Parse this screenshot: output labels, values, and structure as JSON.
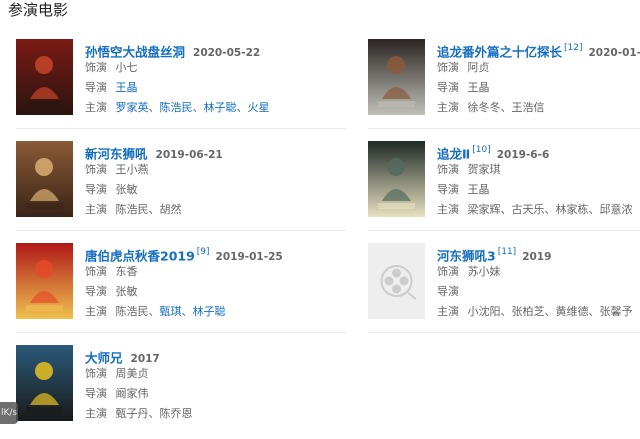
{
  "section": {
    "title": "参演电影"
  },
  "films": [
    {
      "name": "孙悟空大战盘丝洞",
      "ref": "",
      "date": "2020-05-22",
      "role_label": "饰演",
      "role": "小七",
      "director_label": "导演",
      "directors": [
        {
          "text": "王晶",
          "link": true
        }
      ],
      "cast_label": "主演",
      "cast": [
        {
          "text": "罗家英",
          "link": true
        },
        {
          "text": "陈浩民",
          "link": true
        },
        {
          "text": "林子聪",
          "link": true
        },
        {
          "text": "火星",
          "link": true
        }
      ],
      "poster_colors": [
        "#7a1a14",
        "#c8452a",
        "#2a1410"
      ]
    },
    {
      "name": "追龙番外篇之十亿探长",
      "ref": "[12]",
      "date": "2020-01-16",
      "role_label": "饰演",
      "role": "阿贞",
      "director_label": "导演",
      "directors": [
        {
          "text": "王晶",
          "link": false
        }
      ],
      "cast_label": "主演",
      "cast": [
        {
          "text": "徐冬冬",
          "link": false
        },
        {
          "text": "王浩信",
          "link": false
        }
      ],
      "poster_colors": [
        "#2a2422",
        "#8a5a3a",
        "#c0c0b8"
      ]
    },
    {
      "name": "新河东狮吼",
      "ref": "",
      "date": "2019-06-21",
      "role_label": "饰演",
      "role": "王小燕",
      "director_label": "导演",
      "directors": [
        {
          "text": "张敏",
          "link": false
        }
      ],
      "cast_label": "主演",
      "cast": [
        {
          "text": "陈浩民",
          "link": false
        },
        {
          "text": "胡然",
          "link": false
        }
      ],
      "poster_colors": [
        "#8a5a36",
        "#d8b070",
        "#3a2418"
      ]
    },
    {
      "name": "追龙Ⅱ",
      "ref": "[10]",
      "date": "2019-6-6",
      "role_label": "饰演",
      "role": "贺家琪",
      "director_label": "导演",
      "directors": [
        {
          "text": "王晶",
          "link": false
        }
      ],
      "cast_label": "主演",
      "cast": [
        {
          "text": "梁家辉",
          "link": false
        },
        {
          "text": "古天乐",
          "link": false
        },
        {
          "text": "林家栋",
          "link": false
        },
        {
          "text": "邱意浓",
          "link": false
        }
      ],
      "poster_colors": [
        "#1e2a26",
        "#546a5e",
        "#e8e0c0"
      ]
    },
    {
      "name": "唐伯虎点秋香2019",
      "ref": "[9]",
      "date": "2019-01-25",
      "role_label": "饰演",
      "role": "东香",
      "director_label": "导演",
      "directors": [
        {
          "text": "张敏",
          "link": false
        }
      ],
      "cast_label": "主演",
      "cast": [
        {
          "text": "陈浩民",
          "link": false
        },
        {
          "text": "甄琪",
          "link": true
        },
        {
          "text": "林子聪",
          "link": true
        }
      ],
      "poster_colors": [
        "#b01818",
        "#e84a2a",
        "#f0c050"
      ]
    },
    {
      "name": "河东狮吼3",
      "ref": "[11]",
      "date": "2019",
      "role_label": "饰演",
      "role": "苏小妹",
      "director_label": "导演",
      "directors": [],
      "cast_label": "主演",
      "cast": [
        {
          "text": "小沈阳",
          "link": false
        },
        {
          "text": "张柏芝",
          "link": false
        },
        {
          "text": "黄维德",
          "link": false
        },
        {
          "text": "张馨予",
          "link": false
        }
      ],
      "poster_colors": [
        "#eeeeee",
        "#cccccc",
        "#bbbbbb"
      ]
    },
    {
      "name": "大师兄",
      "ref": "",
      "date": "2017",
      "role_label": "饰演",
      "role": "周美贞",
      "director_label": "导演",
      "directors": [
        {
          "text": "阚家伟",
          "link": false
        }
      ],
      "cast_label": "主演",
      "cast": [
        {
          "text": "甄子丹",
          "link": false
        },
        {
          "text": "陈乔恩",
          "link": false
        }
      ],
      "poster_colors": [
        "#2a5a7a",
        "#e8c020",
        "#1a1a1a"
      ]
    }
  ],
  "cast_separator": "、",
  "badge": {
    "text": "lK/s"
  }
}
